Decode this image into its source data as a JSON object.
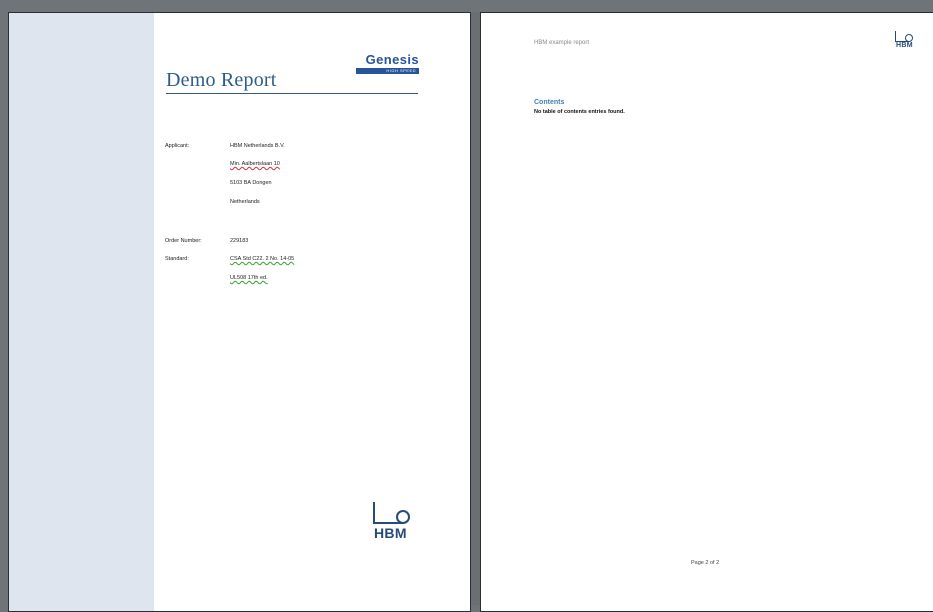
{
  "page1": {
    "title": "Demo Report",
    "brand_logo": {
      "word": "Genesis",
      "tagline": "HIGH SPEED"
    },
    "applicant_label": "Applicant:",
    "applicant_lines": [
      "HBM Netherlands B.V.",
      "Min. Aalbertslaan 10",
      "5103 BA Dongen",
      "Netherlands"
    ],
    "order_label": "Order Number:",
    "order_value": "229183",
    "standard_label": "Standard:",
    "standard_lines": [
      "CSA Std C22. 2 No. 14-05",
      "UL508 17th ed."
    ],
    "footer_logo_text": "HBM"
  },
  "page2": {
    "header_text": "HBM example report",
    "header_logo_text": "HBM",
    "contents_heading": "Contents",
    "contents_note": "No table of contents entries found.",
    "footer": "Page 2 of 2"
  }
}
